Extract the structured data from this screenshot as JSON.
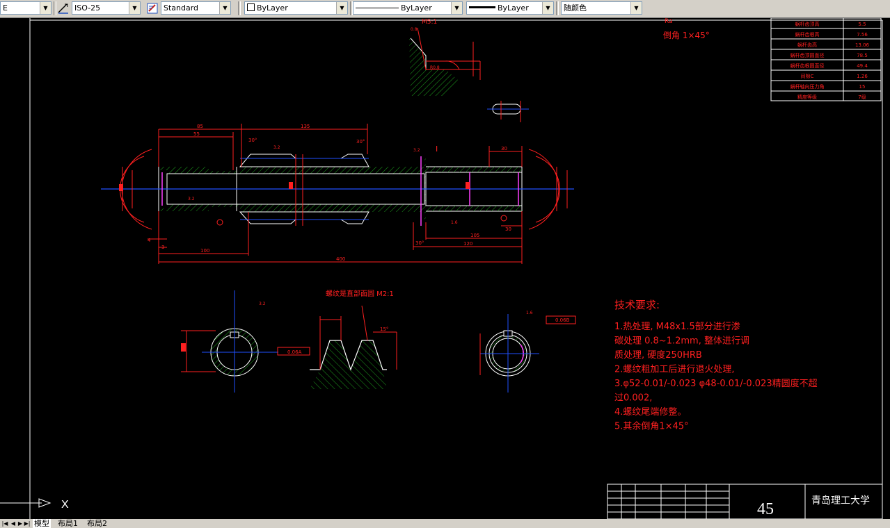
{
  "toolbar": {
    "layer_value": "E",
    "dimstyle_value": "ISO-25",
    "textstyle_value": "Standard",
    "color_value": "ByLayer",
    "linetype_value": "ByLayer",
    "lineweight_value": "ByLayer",
    "plotstyle_value": "随颜色"
  },
  "drawing": {
    "scale_label": "M5:1",
    "chamfer_note": "倒角 1×45°",
    "section_title": "螺纹是直部面圆 M2:1",
    "dims": {
      "d85": "85",
      "d55": "55",
      "d135": "135",
      "d30": "30",
      "d100": "100",
      "d400": "400",
      "d105": "105",
      "d120": "120",
      "d4": "4",
      "d3": "3",
      "d14": "14",
      "a30": "30°",
      "a15": "15°",
      "roman1": "I",
      "r32": "3.2",
      "r16": "1.6",
      "fit": "0.06A",
      "fit2": "0.06B"
    },
    "tech_req": {
      "title": "技术要求:",
      "lines": [
        "1.热处理, M48x1.5部分进行渗",
        "碳处理 0.8~1.2mm, 整体进行调",
        "质处理, 硬度250HRB",
        "2.螺纹粗加工后进行退火处理,",
        "3.φ52-0.01/-0.023 φ48-0.01/-0.023精圆度不超",
        "过0.002,",
        "4.螺纹尾端修整。",
        "5.其余倒角1×45°"
      ]
    },
    "param_table": [
      {
        "name": "蜗杆齿顶高",
        "value": "5.5"
      },
      {
        "name": "蜗杆齿根高",
        "value": "7.56"
      },
      {
        "name": "蜗杆齿高",
        "value": "13.06"
      },
      {
        "name": "蜗杆齿顶圆直径",
        "value": "78.5"
      },
      {
        "name": "蜗杆齿根圆直径",
        "value": "49.4"
      },
      {
        "name": "间隙C",
        "value": "1.26"
      },
      {
        "name": "蜗杆轴向压力角",
        "value": "15"
      },
      {
        "name": "精度等级",
        "value": "7级"
      }
    ],
    "title_block": {
      "number": "45",
      "school": "青岛理工大学"
    }
  },
  "ucs": {
    "x_label": "X"
  },
  "tabs": [
    "模型",
    "布局1",
    "布局2"
  ]
}
